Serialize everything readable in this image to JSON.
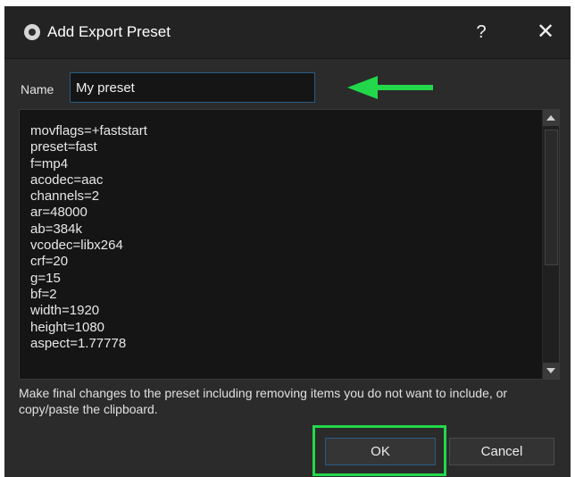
{
  "window": {
    "title": "Add Export Preset",
    "help_label": "?",
    "close_label": "✕"
  },
  "name_field": {
    "label": "Name",
    "value": "My preset"
  },
  "preset_lines": [
    "movflags=+faststart",
    "preset=fast",
    "f=mp4",
    "acodec=aac",
    "channels=2",
    "ar=48000",
    "ab=384k",
    "vcodec=libx264",
    "crf=20",
    "g=15",
    "bf=2",
    "width=1920",
    "height=1080",
    "aspect=1.77778"
  ],
  "hint_text": "Make final changes to the preset including removing items you do not want to include, or copy/paste the clipboard.",
  "buttons": {
    "ok_label": "OK",
    "cancel_label": "Cancel"
  },
  "colors": {
    "annotation_highlight": "#22d84a",
    "dialog_background": "#2b2b2b",
    "field_background": "#151515",
    "focus_border": "#2a5c82"
  },
  "icons": {
    "app": "app-logo-icon",
    "annotation": "green-arrow-left-icon"
  }
}
